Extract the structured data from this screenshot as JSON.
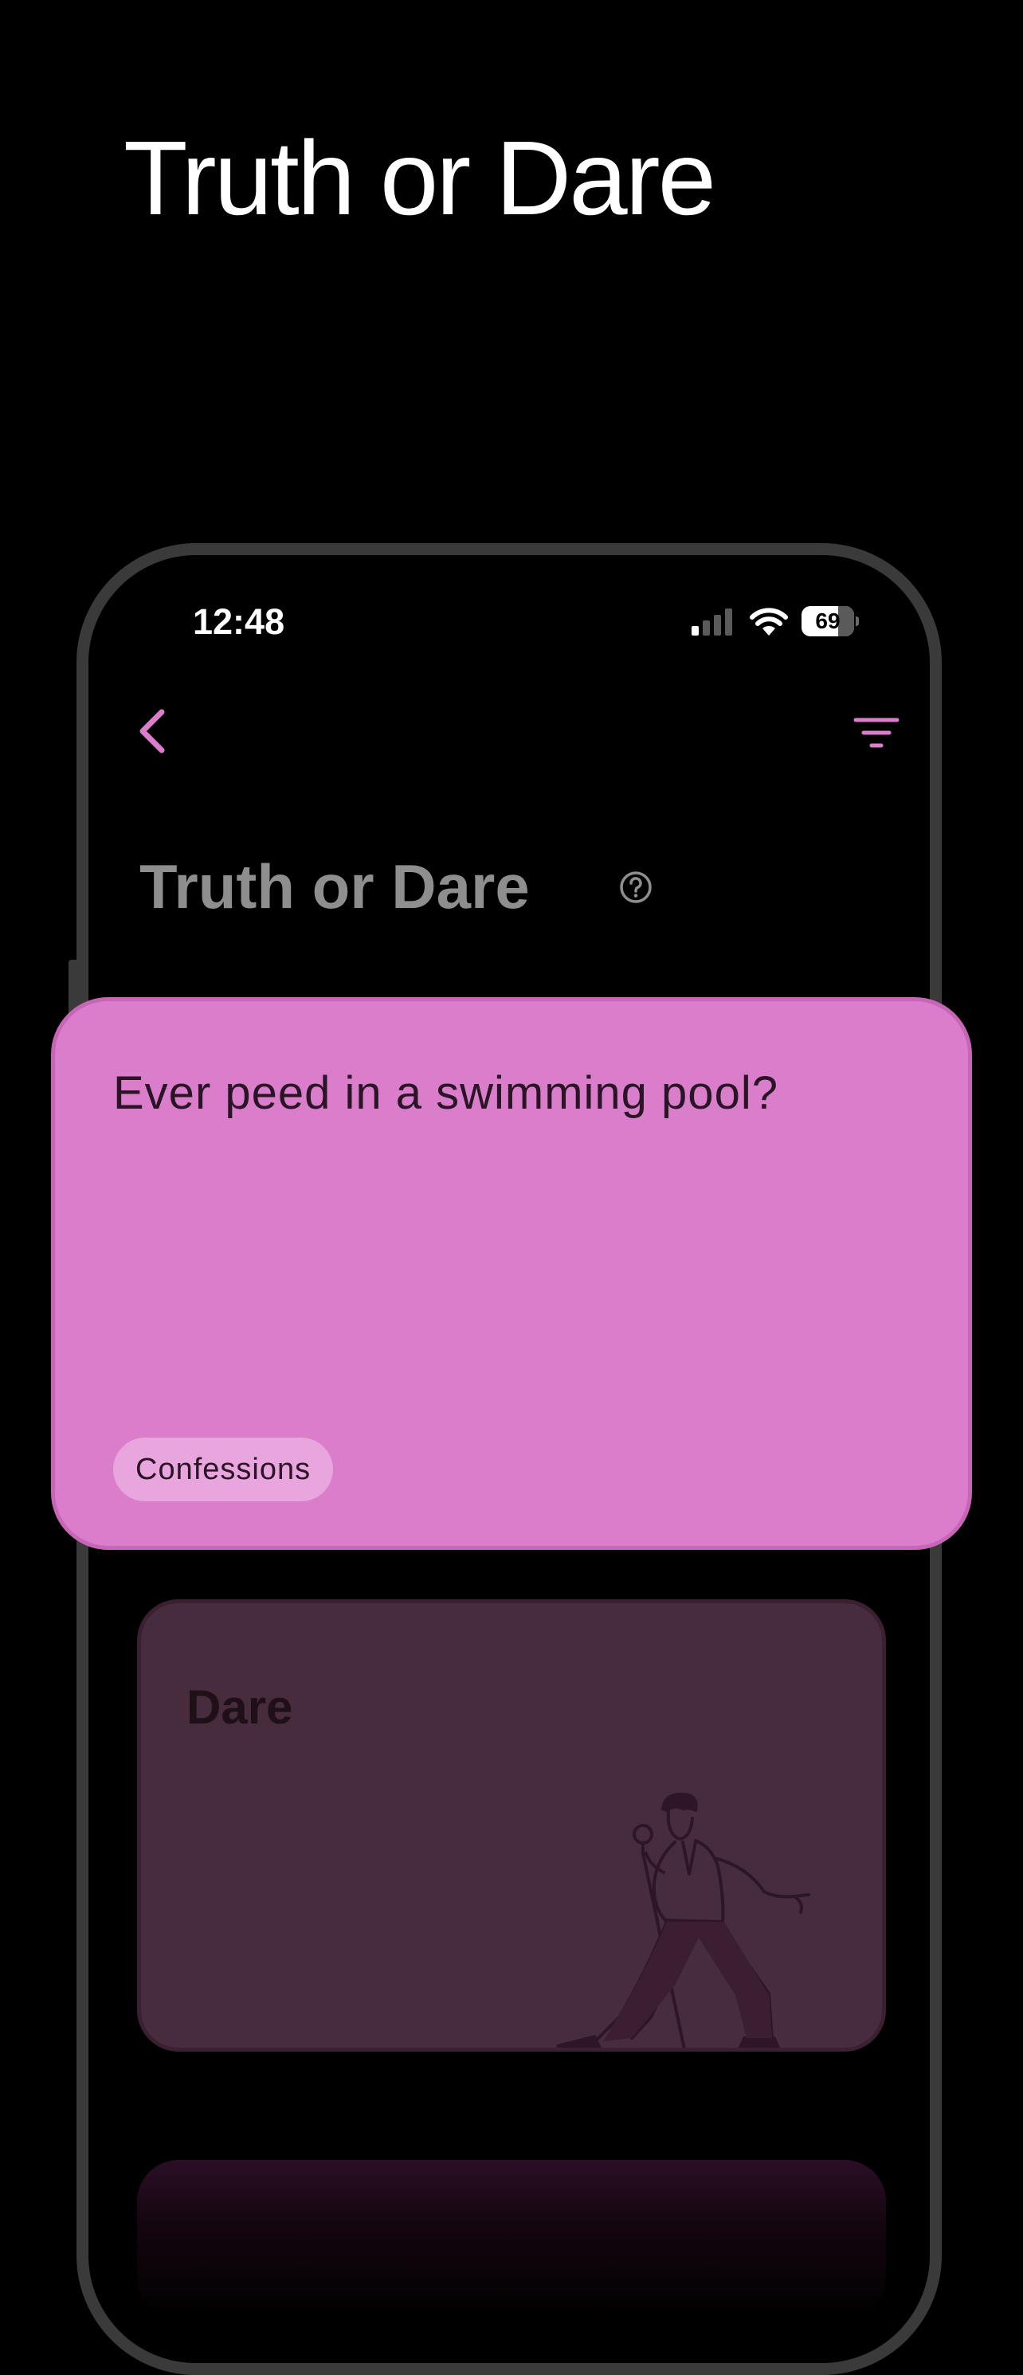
{
  "header": {
    "title": "Truth or Dare"
  },
  "status_bar": {
    "time": "12:48",
    "battery_level": "69",
    "signal_bars_active": 1,
    "signal_bars_total": 4,
    "icons": [
      "signal-icon",
      "wifi-icon",
      "battery-icon"
    ]
  },
  "nav": {
    "back_icon": "chevron-left-icon",
    "filter_icon": "filter-icon",
    "title": "Truth or Dare",
    "help_icon": "help-circle-icon"
  },
  "truth_card": {
    "question": "Ever peed in a swimming pool?",
    "category": "Confessions"
  },
  "dare_card": {
    "label": "Dare",
    "illustration": "singer-with-microphone-illustration"
  },
  "colors": {
    "background": "#000000",
    "accent": "#da7dcb",
    "truth_card": "#da7dcb",
    "tag_background": "#e9a5dd",
    "dare_card": "#472c3e",
    "muted_title": "#8e8e8e",
    "phone_frame": "#3a3a3a"
  }
}
